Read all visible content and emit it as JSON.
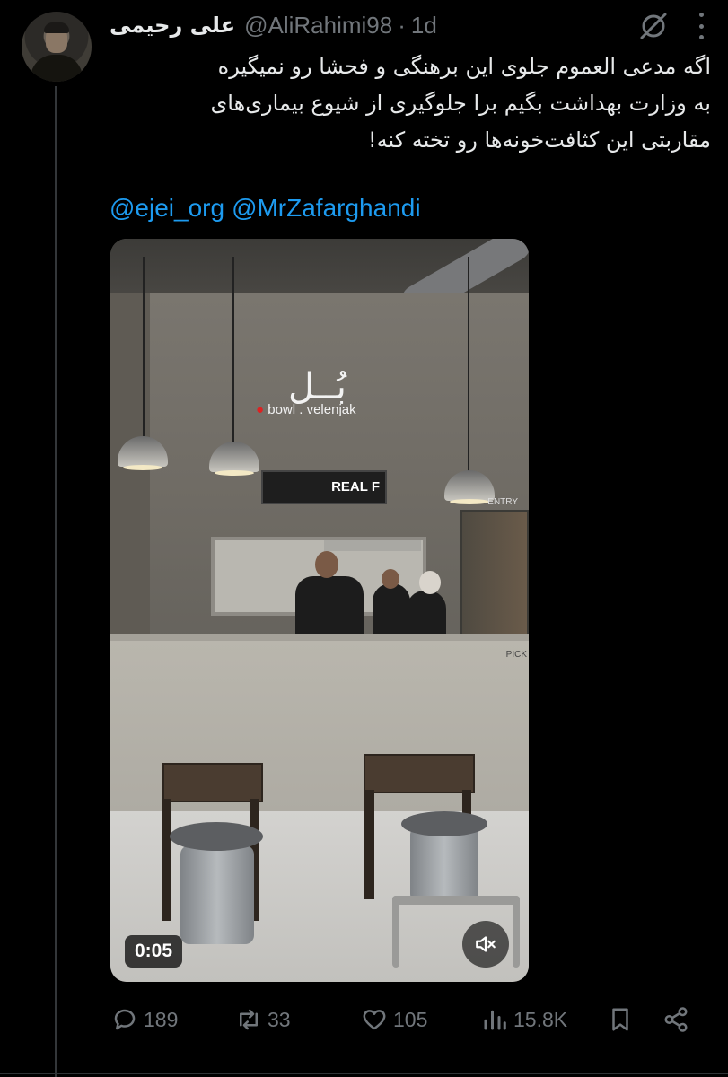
{
  "tweet": {
    "author_name": "علی رحیمی",
    "handle": "@AliRahimi98",
    "separator": "·",
    "time": "1d",
    "text_lines": [
      "اگه مدعی العموم جلوی این برهنگی و فحشا رو نمیگیره",
      "به وزارت بهداشت بگیم برا جلوگیری از شیوع بیماری‌های",
      "مقاربتی این کثافت‌خونه‌ها رو تخته کنه!"
    ],
    "mentions": [
      "@ejei_org",
      "@MrZafarghandi"
    ]
  },
  "media": {
    "sign_glyph": "بُــل",
    "sign_text": "bowl . velenjak",
    "screen_text": "REAL F",
    "entry_text": "ENTRY",
    "counter_text": "PICK",
    "duration": "0:05",
    "muted": true
  },
  "actions": {
    "replies": "189",
    "reposts": "33",
    "likes": "105",
    "views": "15.8K"
  },
  "icons": {
    "grok": "grok-icon",
    "more": "more-icon",
    "reply": "reply-icon",
    "repost": "repost-icon",
    "like": "heart-icon",
    "views": "views-icon",
    "bookmark": "bookmark-icon",
    "share": "share-icon",
    "mute": "mute-icon"
  },
  "colors": {
    "background": "#000000",
    "text": "#e7e9ea",
    "muted": "#71767b",
    "link": "#1d9bf0"
  }
}
